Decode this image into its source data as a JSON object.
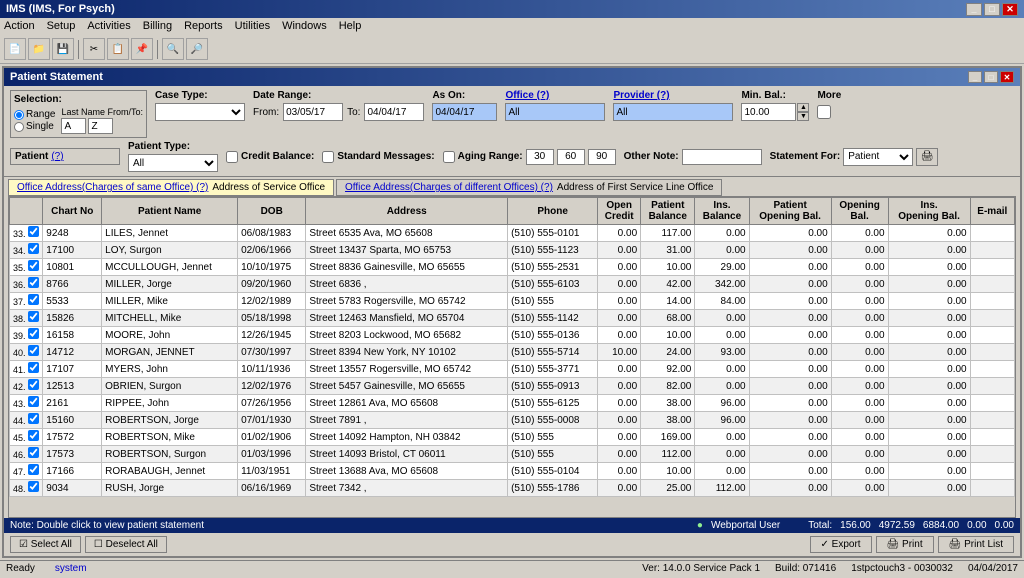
{
  "app_title": "IMS (IMS, For Psych)",
  "window_title": "Patient Statement",
  "menu": {
    "items": [
      "Action",
      "Setup",
      "Activities",
      "Billing",
      "Reports",
      "Utilities",
      "Windows",
      "Help"
    ]
  },
  "filter": {
    "selection_label": "Selection:",
    "last_name_label": "Last Name From/To:",
    "range_label": "Range",
    "single_label": "Single",
    "from_value": "A",
    "to_value": "Z",
    "case_type_label": "Case Type:",
    "case_type_value": "",
    "patient_type_label": "Patient Type:",
    "patient_type_value": "All",
    "date_range_label": "Date Range:",
    "from_date": "03/05/17",
    "to_date": "04/04/17",
    "as_on_label": "As On:",
    "as_on_date": "04/04/17",
    "credit_balance_label": "Credit Balance:",
    "standard_messages_label": "Standard Messages:",
    "aging_range_label": "Aging Range:",
    "aging_30": "30",
    "aging_60": "60",
    "aging_90": "90",
    "office_label": "Office (?)",
    "office_value": "All",
    "provider_label": "Provider (?)",
    "provider_value": "All",
    "other_note_label": "Other Note:",
    "min_bal_label": "Min. Bal.:",
    "min_bal_value": "10.00",
    "more_label": "More",
    "statement_for_label": "Statement For:",
    "statement_for_value": "Patient",
    "patient_help": "(?)"
  },
  "tabs": {
    "tab1_label": "Office Address(Charges of same Office) (?)",
    "tab1_address": "Address of Service Office",
    "tab2_label": "Office Address(Charges of different Offices) (?)",
    "tab2_address": "Address of First Service Line Office"
  },
  "table": {
    "columns": [
      "",
      "Chart No",
      "Patient Name",
      "DOB",
      "Address",
      "Phone",
      "Open Credit",
      "Patient Balance",
      "Ins. Balance",
      "Patient Opening Bal.",
      "Opening Bal.",
      "Ins. Opening Bal.",
      "E-mail"
    ],
    "rows": [
      {
        "num": "33.",
        "checked": true,
        "chart": "9248",
        "name": "LILES, Jennet",
        "dob": "06/08/1983",
        "address": "Street 6535 Ava, MO 65608",
        "phone": "(510) 555-0101",
        "open_credit": "0.00",
        "pat_bal": "117.00",
        "ins_bal": "0.00",
        "pat_open": "0.00",
        "open": "0.00",
        "ins_open": "0.00",
        "email": ""
      },
      {
        "num": "34.",
        "checked": true,
        "chart": "17100",
        "name": "LOY, Surgon",
        "dob": "02/06/1966",
        "address": "Street 13437 Sparta, MO 65753",
        "phone": "(510) 555-1123",
        "open_credit": "0.00",
        "pat_bal": "31.00",
        "ins_bal": "0.00",
        "pat_open": "0.00",
        "open": "0.00",
        "ins_open": "0.00",
        "email": ""
      },
      {
        "num": "35.",
        "checked": true,
        "chart": "10801",
        "name": "MCCULLOUGH, Jennet",
        "dob": "10/10/1975",
        "address": "Street 8836 Gainesville, MO 65655",
        "phone": "(510) 555-2531",
        "open_credit": "0.00",
        "pat_bal": "10.00",
        "ins_bal": "29.00",
        "pat_open": "0.00",
        "open": "0.00",
        "ins_open": "0.00",
        "email": ""
      },
      {
        "num": "36.",
        "checked": true,
        "chart": "8766",
        "name": "MILLER, Jorge",
        "dob": "09/20/1960",
        "address": "Street 6836 ,",
        "phone": "(510) 555-6103",
        "open_credit": "0.00",
        "pat_bal": "42.00",
        "ins_bal": "342.00",
        "pat_open": "0.00",
        "open": "0.00",
        "ins_open": "0.00",
        "email": ""
      },
      {
        "num": "37.",
        "checked": true,
        "chart": "5533",
        "name": "MILLER, Mike",
        "dob": "12/02/1989",
        "address": "Street 5783 Rogersville, MO 65742",
        "phone": "(510) 555",
        "open_credit": "0.00",
        "pat_bal": "14.00",
        "ins_bal": "84.00",
        "pat_open": "0.00",
        "open": "0.00",
        "ins_open": "0.00",
        "email": ""
      },
      {
        "num": "38.",
        "checked": true,
        "chart": "15826",
        "name": "MITCHELL, Mike",
        "dob": "05/18/1998",
        "address": "Street 12463 Mansfield, MO 65704",
        "phone": "(510) 555-1142",
        "open_credit": "0.00",
        "pat_bal": "68.00",
        "ins_bal": "0.00",
        "pat_open": "0.00",
        "open": "0.00",
        "ins_open": "0.00",
        "email": ""
      },
      {
        "num": "39.",
        "checked": true,
        "chart": "16158",
        "name": "MOORE, John",
        "dob": "12/26/1945",
        "address": "Street 8203 Lockwood, MO 65682",
        "phone": "(510) 555-0136",
        "open_credit": "0.00",
        "pat_bal": "10.00",
        "ins_bal": "0.00",
        "pat_open": "0.00",
        "open": "0.00",
        "ins_open": "0.00",
        "email": ""
      },
      {
        "num": "40.",
        "checked": true,
        "chart": "14712",
        "name": "MORGAN, JENNET",
        "dob": "07/30/1997",
        "address": "Street 8394 New York, NY 10102",
        "phone": "(510) 555-5714",
        "open_credit": "10.00",
        "pat_bal": "24.00",
        "ins_bal": "93.00",
        "pat_open": "0.00",
        "open": "0.00",
        "ins_open": "0.00",
        "email": ""
      },
      {
        "num": "41.",
        "checked": true,
        "chart": "17107",
        "name": "MYERS, John",
        "dob": "10/11/1936",
        "address": "Street 13557 Rogersville, MO 65742",
        "phone": "(510) 555-3771",
        "open_credit": "0.00",
        "pat_bal": "92.00",
        "ins_bal": "0.00",
        "pat_open": "0.00",
        "open": "0.00",
        "ins_open": "0.00",
        "email": ""
      },
      {
        "num": "42.",
        "checked": true,
        "chart": "12513",
        "name": "OBRIEN, Surgon",
        "dob": "12/02/1976",
        "address": "Street 5457 Gainesville, MO 65655",
        "phone": "(510) 555-0913",
        "open_credit": "0.00",
        "pat_bal": "82.00",
        "ins_bal": "0.00",
        "pat_open": "0.00",
        "open": "0.00",
        "ins_open": "0.00",
        "email": ""
      },
      {
        "num": "43.",
        "checked": true,
        "chart": "2161",
        "name": "RIPPEE, John",
        "dob": "07/26/1956",
        "address": "Street 12861 Ava, MO 65608",
        "phone": "(510) 555-6125",
        "open_credit": "0.00",
        "pat_bal": "38.00",
        "ins_bal": "96.00",
        "pat_open": "0.00",
        "open": "0.00",
        "ins_open": "0.00",
        "email": ""
      },
      {
        "num": "44.",
        "checked": true,
        "chart": "15160",
        "name": "ROBERTSON, Jorge",
        "dob": "07/01/1930",
        "address": "Street 7891 ,",
        "phone": "(510) 555-0008",
        "open_credit": "0.00",
        "pat_bal": "38.00",
        "ins_bal": "96.00",
        "pat_open": "0.00",
        "open": "0.00",
        "ins_open": "0.00",
        "email": ""
      },
      {
        "num": "45.",
        "checked": true,
        "chart": "17572",
        "name": "ROBERTSON, Mike",
        "dob": "01/02/1906",
        "address": "Street 14092 Hampton, NH 03842",
        "phone": "(510) 555",
        "open_credit": "0.00",
        "pat_bal": "169.00",
        "ins_bal": "0.00",
        "pat_open": "0.00",
        "open": "0.00",
        "ins_open": "0.00",
        "email": ""
      },
      {
        "num": "46.",
        "checked": true,
        "chart": "17573",
        "name": "ROBERTSON, Surgon",
        "dob": "01/03/1996",
        "address": "Street 14093 Bristol, CT 06011",
        "phone": "(510) 555",
        "open_credit": "0.00",
        "pat_bal": "112.00",
        "ins_bal": "0.00",
        "pat_open": "0.00",
        "open": "0.00",
        "ins_open": "0.00",
        "email": ""
      },
      {
        "num": "47.",
        "checked": true,
        "chart": "17166",
        "name": "RORABAUGH, Jennet",
        "dob": "11/03/1951",
        "address": "Street 13688 Ava, MO 65608",
        "phone": "(510) 555-0104",
        "open_credit": "0.00",
        "pat_bal": "10.00",
        "ins_bal": "0.00",
        "pat_open": "0.00",
        "open": "0.00",
        "ins_open": "0.00",
        "email": ""
      },
      {
        "num": "48.",
        "checked": true,
        "chart": "9034",
        "name": "RUSH, Jorge",
        "dob": "06/16/1969",
        "address": "Street 7342 ,",
        "phone": "(510) 555-1786",
        "open_credit": "0.00",
        "pat_bal": "25.00",
        "ins_bal": "112.00",
        "pat_open": "0.00",
        "open": "0.00",
        "ins_open": "0.00",
        "email": ""
      }
    ],
    "totals": {
      "label": "Total:",
      "open_credit": "156.00",
      "pat_bal": "4972.59",
      "ins_bal": "6884.00",
      "pat_open": "0.00",
      "open": "0.00"
    }
  },
  "bottom": {
    "note": "Note: Double click to view patient statement",
    "user_icon": "●",
    "user": "Webportal User",
    "select_all": "Select All",
    "deselect_all": "Deselect All",
    "export": "Export",
    "print": "Print",
    "print_list": "Print List"
  },
  "status": {
    "ready": "Ready",
    "system": "system",
    "version": "Ver: 14.0.0 Service Pack 1",
    "build": "Build: 071416",
    "instance": "1stpctouch3 - 0030032",
    "date": "04/04/2017"
  }
}
